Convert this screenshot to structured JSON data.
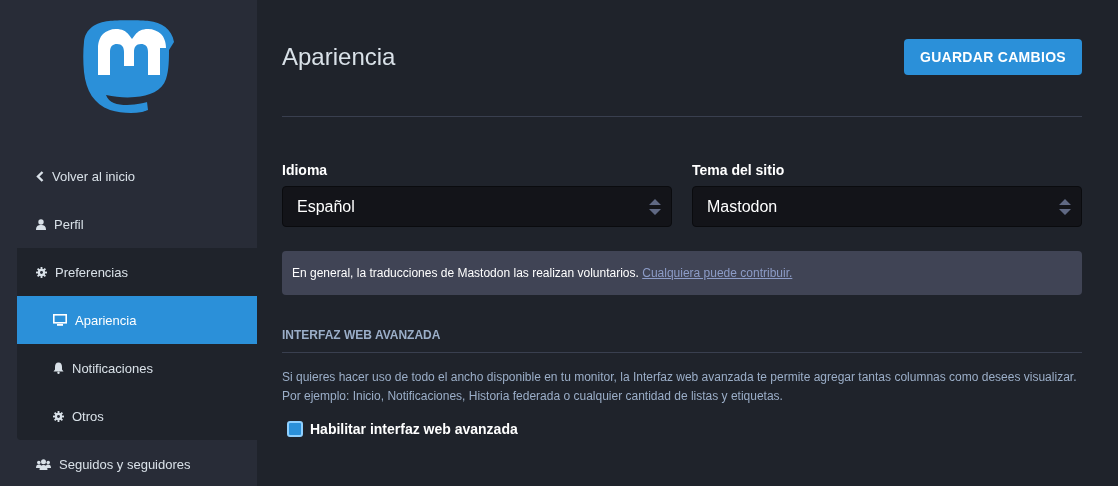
{
  "sidebar": {
    "items": [
      {
        "label": "Volver al inicio",
        "selected": false
      },
      {
        "label": "Perfil",
        "selected": false
      },
      {
        "label": "Preferencias",
        "selected": false,
        "expanded": true,
        "children": [
          {
            "label": "Apariencia",
            "selected": true
          },
          {
            "label": "Notificaciones",
            "selected": false
          },
          {
            "label": "Otros",
            "selected": false
          }
        ]
      },
      {
        "label": "Seguidos y seguidores",
        "selected": false
      }
    ]
  },
  "page": {
    "title": "Apariencia",
    "save_button": "GUARDAR CAMBIOS"
  },
  "fields": [
    {
      "label": "Idioma",
      "value": "Español"
    },
    {
      "label": "Tema del sitio",
      "value": "Mastodon"
    }
  ],
  "notice": {
    "text": "En general, la traducciones de Mastodon las realizan voluntarios.",
    "link": "Cualquiera puede contribuir."
  },
  "section": {
    "heading": "INTERFAZ WEB AVANZADA",
    "description": "Si quieres hacer uso de todo el ancho disponible en tu monitor, la Interfaz web avanzada te permite agregar tantas columnas como desees visualizar. Por ejemplo: Inicio, Notificaciones, Historia federada o cualquier cantidad de listas y etiquetas.",
    "checkbox": {
      "label": "Habilitar interfaz web avanzada",
      "checked": true
    }
  }
}
